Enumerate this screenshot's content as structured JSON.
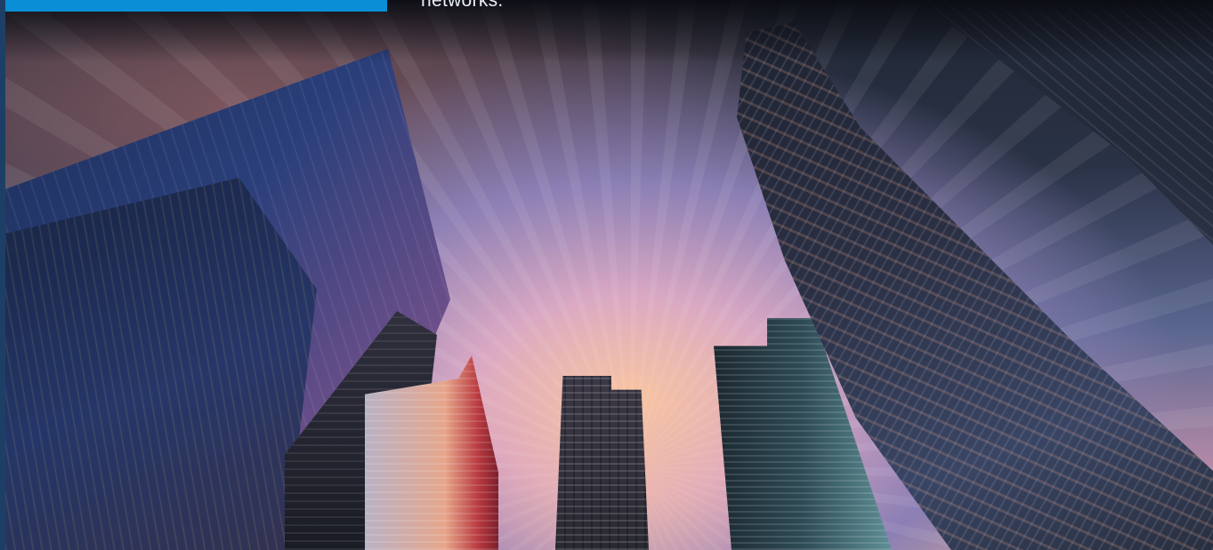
{
  "header": {
    "caption_text": "networks."
  },
  "colors": {
    "banner_blue": "#0a8fd6",
    "left_edge": "#1d3f66"
  },
  "hero_image": {
    "icon": "city-skyline-photo"
  }
}
